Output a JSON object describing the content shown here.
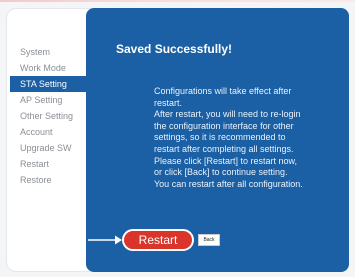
{
  "menu": {
    "items": [
      {
        "label": "System"
      },
      {
        "label": "Work Mode"
      },
      {
        "label": "STA Setting"
      },
      {
        "label": "AP Setting"
      },
      {
        "label": "Other Setting"
      },
      {
        "label": "Account"
      },
      {
        "label": "Upgrade SW"
      },
      {
        "label": "Restart"
      },
      {
        "label": "Restore"
      }
    ],
    "active": "STA Setting"
  },
  "main": {
    "title": "Saved Successfully!",
    "message_lines": [
      "Configurations will take effect after",
      "restart.",
      "After restart, you will need to re-login",
      "the configuration interface for other",
      "settings, so it is recommended to",
      "restart after completing all settings.",
      "Please click [Restart] to restart now,",
      "or click [Back] to continue setting.",
      "You can restart after all configuration."
    ]
  },
  "buttons": {
    "restart_label": "Restart",
    "back_label": "Back"
  },
  "colors": {
    "panel_blue": "#1b5fa4",
    "restart_red": "#d9352b",
    "header_pink": "#f3c9cc"
  }
}
